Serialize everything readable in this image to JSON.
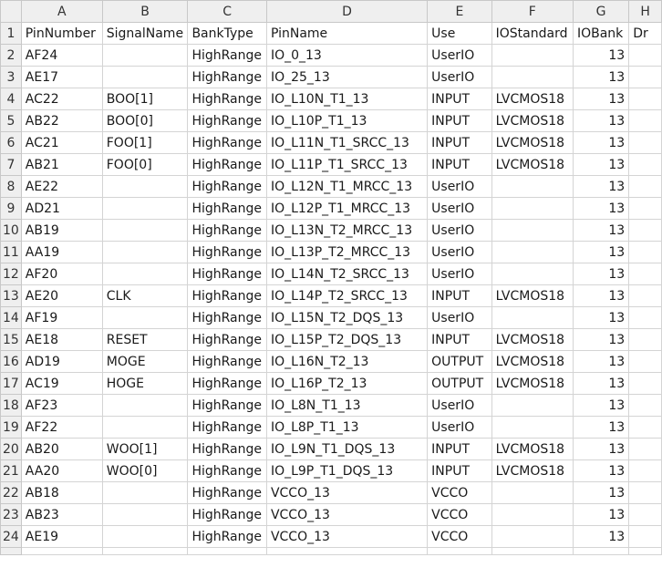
{
  "columns": [
    "A",
    "B",
    "C",
    "D",
    "E",
    "F",
    "G",
    "H"
  ],
  "header": {
    "row_number": "1",
    "cells": [
      "PinNumber",
      "SignalName",
      "BankType",
      "PinName",
      "Use",
      "IOStandard",
      "IOBank",
      "Dr"
    ]
  },
  "rows": [
    {
      "n": "2",
      "cells": [
        "AF24",
        "",
        "HighRange",
        "IO_0_13",
        "UserIO",
        "",
        "13",
        ""
      ]
    },
    {
      "n": "3",
      "cells": [
        "AE17",
        "",
        "HighRange",
        "IO_25_13",
        "UserIO",
        "",
        "13",
        ""
      ]
    },
    {
      "n": "4",
      "cells": [
        "AC22",
        "BOO[1]",
        "HighRange",
        "IO_L10N_T1_13",
        "INPUT",
        "LVCMOS18",
        "13",
        ""
      ]
    },
    {
      "n": "5",
      "cells": [
        "AB22",
        "BOO[0]",
        "HighRange",
        "IO_L10P_T1_13",
        "INPUT",
        "LVCMOS18",
        "13",
        ""
      ]
    },
    {
      "n": "6",
      "cells": [
        "AC21",
        "FOO[1]",
        "HighRange",
        "IO_L11N_T1_SRCC_13",
        "INPUT",
        "LVCMOS18",
        "13",
        ""
      ]
    },
    {
      "n": "7",
      "cells": [
        "AB21",
        "FOO[0]",
        "HighRange",
        "IO_L11P_T1_SRCC_13",
        "INPUT",
        "LVCMOS18",
        "13",
        ""
      ]
    },
    {
      "n": "8",
      "cells": [
        "AE22",
        "",
        "HighRange",
        "IO_L12N_T1_MRCC_13",
        "UserIO",
        "",
        "13",
        ""
      ]
    },
    {
      "n": "9",
      "cells": [
        "AD21",
        "",
        "HighRange",
        "IO_L12P_T1_MRCC_13",
        "UserIO",
        "",
        "13",
        ""
      ]
    },
    {
      "n": "10",
      "cells": [
        "AB19",
        "",
        "HighRange",
        "IO_L13N_T2_MRCC_13",
        "UserIO",
        "",
        "13",
        ""
      ]
    },
    {
      "n": "11",
      "cells": [
        "AA19",
        "",
        "HighRange",
        "IO_L13P_T2_MRCC_13",
        "UserIO",
        "",
        "13",
        ""
      ]
    },
    {
      "n": "12",
      "cells": [
        "AF20",
        "",
        "HighRange",
        "IO_L14N_T2_SRCC_13",
        "UserIO",
        "",
        "13",
        ""
      ]
    },
    {
      "n": "13",
      "cells": [
        "AE20",
        "CLK",
        "HighRange",
        "IO_L14P_T2_SRCC_13",
        "INPUT",
        "LVCMOS18",
        "13",
        ""
      ]
    },
    {
      "n": "14",
      "cells": [
        "AF19",
        "",
        "HighRange",
        "IO_L15N_T2_DQS_13",
        "UserIO",
        "",
        "13",
        ""
      ]
    },
    {
      "n": "15",
      "cells": [
        "AE18",
        "RESET",
        "HighRange",
        "IO_L15P_T2_DQS_13",
        "INPUT",
        "LVCMOS18",
        "13",
        ""
      ]
    },
    {
      "n": "16",
      "cells": [
        "AD19",
        "MOGE",
        "HighRange",
        "IO_L16N_T2_13",
        "OUTPUT",
        "LVCMOS18",
        "13",
        ""
      ]
    },
    {
      "n": "17",
      "cells": [
        "AC19",
        "HOGE",
        "HighRange",
        "IO_L16P_T2_13",
        "OUTPUT",
        "LVCMOS18",
        "13",
        ""
      ]
    },
    {
      "n": "18",
      "cells": [
        "AF23",
        "",
        "HighRange",
        "IO_L8N_T1_13",
        "UserIO",
        "",
        "13",
        ""
      ]
    },
    {
      "n": "19",
      "cells": [
        "AF22",
        "",
        "HighRange",
        "IO_L8P_T1_13",
        "UserIO",
        "",
        "13",
        ""
      ]
    },
    {
      "n": "20",
      "cells": [
        "AB20",
        "WOO[1]",
        "HighRange",
        "IO_L9N_T1_DQS_13",
        "INPUT",
        "LVCMOS18",
        "13",
        ""
      ]
    },
    {
      "n": "21",
      "cells": [
        "AA20",
        "WOO[0]",
        "HighRange",
        "IO_L9P_T1_DQS_13",
        "INPUT",
        "LVCMOS18",
        "13",
        ""
      ]
    },
    {
      "n": "22",
      "cells": [
        "AB18",
        "",
        "HighRange",
        "VCCO_13",
        "VCCO",
        "",
        "13",
        ""
      ]
    },
    {
      "n": "23",
      "cells": [
        "AB23",
        "",
        "HighRange",
        "VCCO_13",
        "VCCO",
        "",
        "13",
        ""
      ]
    },
    {
      "n": "24",
      "cells": [
        "AE19",
        "",
        "HighRange",
        "VCCO_13",
        "VCCO",
        "",
        "13",
        ""
      ]
    }
  ]
}
